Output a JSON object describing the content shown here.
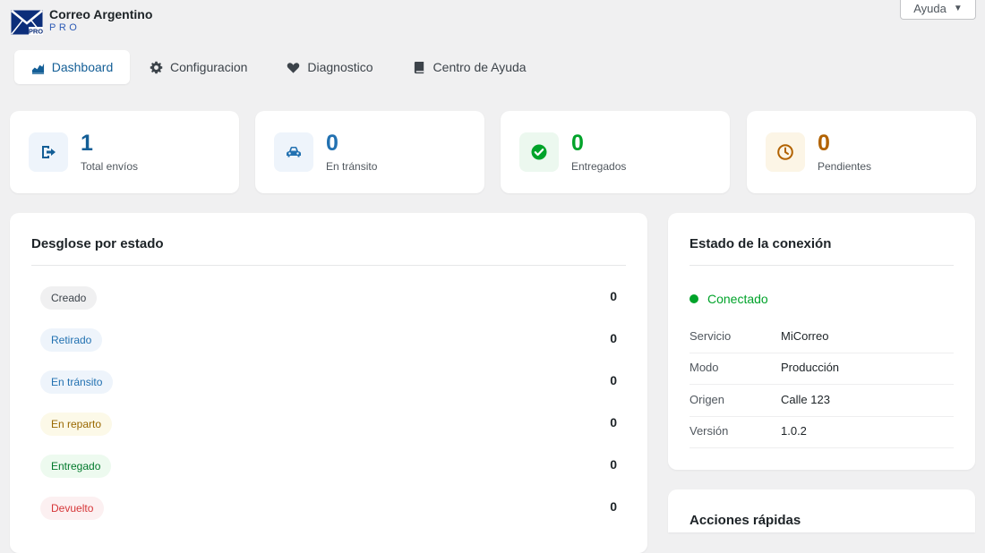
{
  "app": {
    "title": "Correo Argentino",
    "subtitle": "PRO",
    "logo_badge": "PRO",
    "help_label": "Ayuda"
  },
  "tabs": [
    {
      "label": "Dashboard",
      "icon": "chart-area-icon",
      "active": true
    },
    {
      "label": "Configuracion",
      "icon": "gear-icon",
      "active": false
    },
    {
      "label": "Diagnostico",
      "icon": "heart-icon",
      "active": false
    },
    {
      "label": "Centro de Ayuda",
      "icon": "book-icon",
      "active": false
    }
  ],
  "stats": [
    {
      "value": "1",
      "label": "Total envíos",
      "icon": "export-icon",
      "color": "#135e96",
      "bg": "#eef4fb"
    },
    {
      "value": "0",
      "label": "En tránsito",
      "icon": "car-icon",
      "color": "#2271b1",
      "bg": "#eef4fb"
    },
    {
      "value": "0",
      "label": "Entregados",
      "icon": "check-circle-icon",
      "color": "#00a32a",
      "bg": "#ecf8ef"
    },
    {
      "value": "0",
      "label": "Pendientes",
      "icon": "clock-icon",
      "color": "#b26200",
      "bg": "#fcf5e6"
    }
  ],
  "breakdown": {
    "title": "Desglose por estado",
    "rows": [
      {
        "label": "Creado",
        "count": "0",
        "bg": "#f0f0f1",
        "color": "#3c434a"
      },
      {
        "label": "Retirado",
        "count": "0",
        "bg": "#eef4fb",
        "color": "#2271b1"
      },
      {
        "label": "En tránsito",
        "count": "0",
        "bg": "#eef4fb",
        "color": "#2271b1"
      },
      {
        "label": "En reparto",
        "count": "0",
        "bg": "#fcf9e8",
        "color": "#996800"
      },
      {
        "label": "Entregado",
        "count": "0",
        "bg": "#edfaef",
        "color": "#00792b"
      },
      {
        "label": "Devuelto",
        "count": "0",
        "bg": "#fcf0f1",
        "color": "#d63638"
      }
    ]
  },
  "connection": {
    "title": "Estado de la conexión",
    "status": "Conectado",
    "status_color": "#00a32a",
    "rows": [
      {
        "key": "Servicio",
        "value": "MiCorreo"
      },
      {
        "key": "Modo",
        "value": "Producción"
      },
      {
        "key": "Origen",
        "value": "Calle 123"
      },
      {
        "key": "Versión",
        "value": "1.0.2"
      }
    ]
  },
  "quick_actions": {
    "title": "Acciones rápidas"
  }
}
